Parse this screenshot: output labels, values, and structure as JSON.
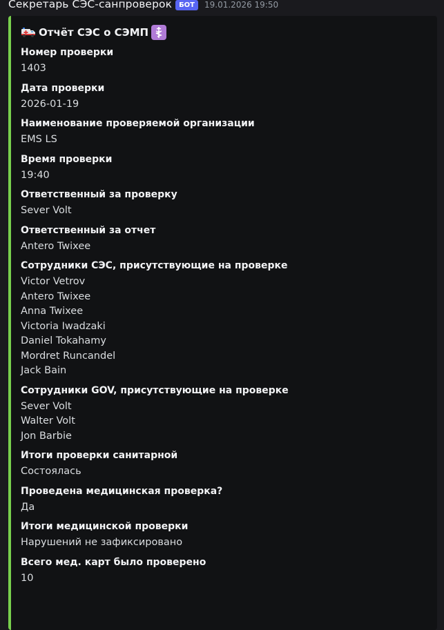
{
  "message": {
    "author": "Секретарь СЭС-санпроверок",
    "badge": "БОТ",
    "timestamp": "19.01.2026 19:50"
  },
  "embed": {
    "accent_color": "#78d04d",
    "title_icon_left": "ambulance-emoji",
    "title": "Отчёт СЭС о СЭМП",
    "title_icon_right": "medical-symbol-emoji",
    "fields": [
      {
        "name": "Номер проверки",
        "values": [
          "1403"
        ]
      },
      {
        "name": "Дата проверки",
        "values": [
          "2026-01-19"
        ]
      },
      {
        "name": "Наименование проверяемой организации",
        "values": [
          "EMS LS"
        ]
      },
      {
        "name": "Время проверки",
        "values": [
          "19:40"
        ]
      },
      {
        "name": "Ответственный за проверку",
        "values": [
          "Sever Volt"
        ]
      },
      {
        "name": "Ответственный за отчет",
        "values": [
          "Antero Twixee"
        ]
      },
      {
        "name": "Сотрудники СЭС, присутствующие на проверке",
        "values": [
          "Victor Vetrov",
          "Antero Twixee",
          "Anna Twixee",
          "Victoria Iwadzaki",
          "Daniel Tokahamy",
          "Mordret Runcandel",
          "Jack Bain"
        ]
      },
      {
        "name": "Сотрудники GOV, присутствующие на проверке",
        "values": [
          "Sever Volt",
          "Walter Volt",
          "Jon Barbie"
        ]
      },
      {
        "name": "Итоги проверки санитарной",
        "values": [
          "Состоялась"
        ]
      },
      {
        "name": "Проведена медицинская проверка?",
        "values": [
          "Да"
        ]
      },
      {
        "name": "Итоги медицинской проверки",
        "values": [
          "Нарушений не зафиксировано"
        ]
      },
      {
        "name": "Всего мед. карт было проверено",
        "values": [
          "10"
        ]
      }
    ]
  }
}
